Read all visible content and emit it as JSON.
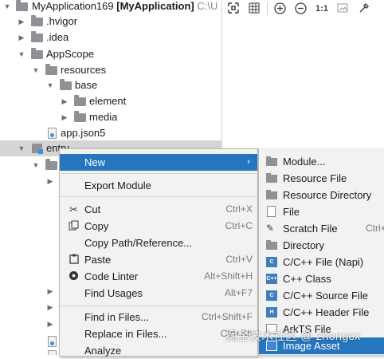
{
  "tree": {
    "root_name": "MyApplication169",
    "root_module": "[MyApplication]",
    "root_path": "C:\\U",
    "items": [
      {
        "label": "MyApplication169"
      },
      {
        "label": ".hvigor"
      },
      {
        "label": ".idea"
      },
      {
        "label": "AppScope"
      },
      {
        "label": "resources"
      },
      {
        "label": "base"
      },
      {
        "label": "element"
      },
      {
        "label": "media"
      },
      {
        "label": "app.json5"
      },
      {
        "label": "entry"
      }
    ]
  },
  "toolbar": {
    "zoom_label": "1:1"
  },
  "menu": {
    "items": [
      {
        "label": "New",
        "shortcut": "",
        "submenu": "›"
      },
      {
        "label": "Export Module",
        "shortcut": ""
      },
      {
        "label": "Cut",
        "shortcut": "Ctrl+X"
      },
      {
        "label": "Copy",
        "shortcut": "Ctrl+C"
      },
      {
        "label": "Copy Path/Reference...",
        "shortcut": ""
      },
      {
        "label": "Paste",
        "shortcut": "Ctrl+V"
      },
      {
        "label": "Code Linter",
        "shortcut": "Alt+Shift+H"
      },
      {
        "label": "Find Usages",
        "shortcut": "Alt+F7"
      },
      {
        "label": "Find in Files...",
        "shortcut": "Ctrl+Shift+F"
      },
      {
        "label": "Replace in Files...",
        "shortcut": "Ctrl+Sh"
      },
      {
        "label": "Analyze",
        "shortcut": ""
      }
    ]
  },
  "submenu": {
    "items": [
      {
        "label": "Module...",
        "shortcut": ""
      },
      {
        "label": "Resource File",
        "shortcut": ""
      },
      {
        "label": "Resource Directory",
        "shortcut": ""
      },
      {
        "label": "File",
        "shortcut": ""
      },
      {
        "label": "Scratch File",
        "shortcut": "Ctrl+"
      },
      {
        "label": "Directory",
        "shortcut": ""
      },
      {
        "label": "C/C++ File (Napi)",
        "shortcut": ""
      },
      {
        "label": "C++ Class",
        "shortcut": ""
      },
      {
        "label": "C/C++ Source File",
        "shortcut": ""
      },
      {
        "label": "C/C++ Header File",
        "shortcut": ""
      },
      {
        "label": "ArkTS File",
        "shortcut": ""
      },
      {
        "label": "Image Asset",
        "shortcut": ""
      }
    ]
  },
  "watermark": "掘金技术社区 @ zhongcx",
  "colors": {
    "accent": "#2675bf",
    "menu_bg": "#f2f2f2",
    "folder": "#8e9296"
  }
}
